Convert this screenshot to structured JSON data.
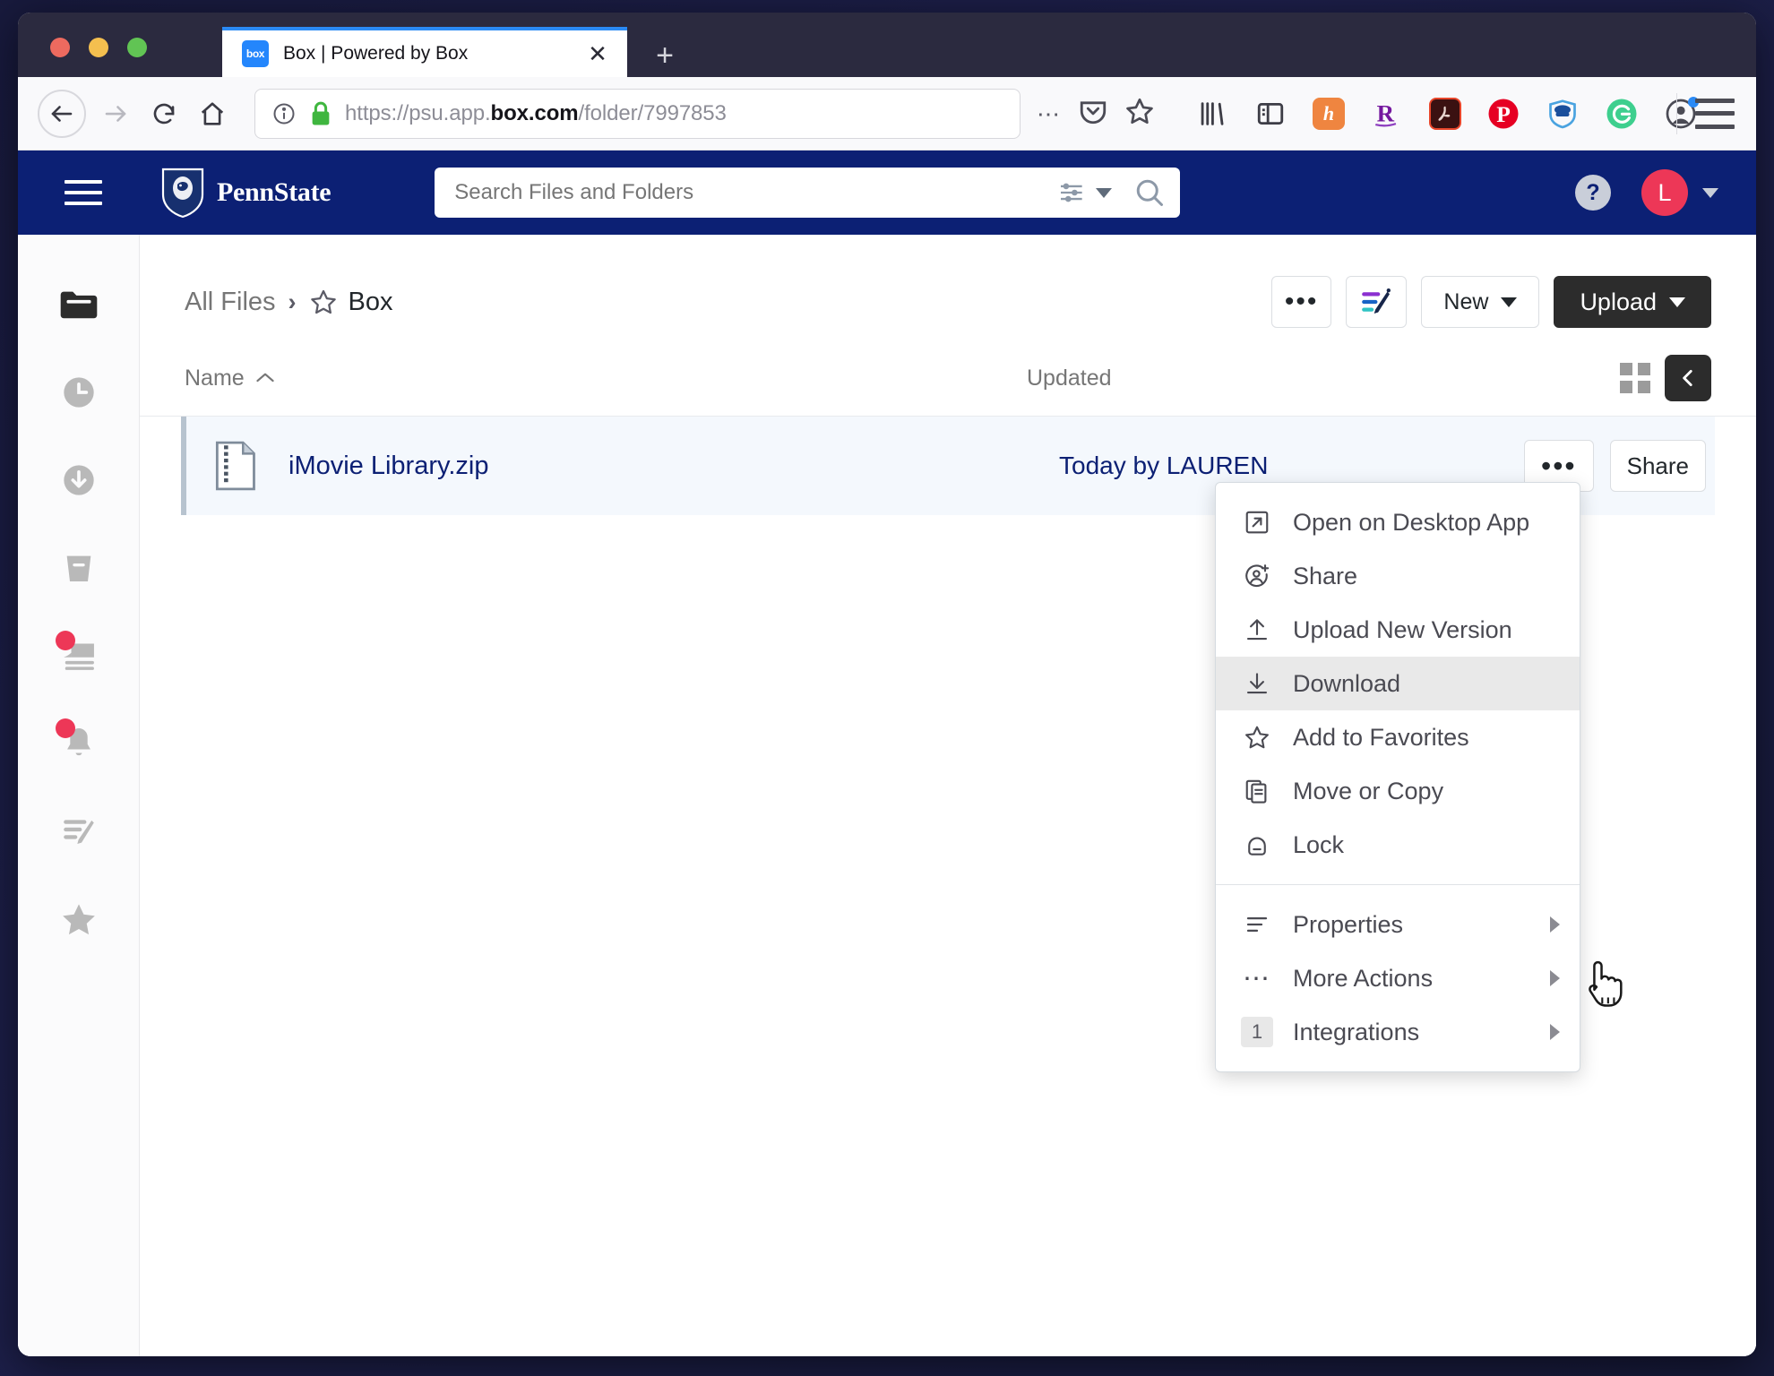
{
  "browser": {
    "tab": {
      "title": "Box | Powered by Box",
      "favicon_label": "box",
      "close_label": "✕"
    },
    "new_tab_label": "+",
    "url": {
      "scheme": "https://psu.app.",
      "domain": "box.com",
      "path": "/folder/7997853"
    },
    "toolbar_icons": [
      "page-actions-icon",
      "pocket-icon",
      "bookmark-star-icon",
      "library-icon",
      "sidebar-icon",
      "hypothesis-icon",
      "rstudio-icon",
      "adobe-acrobat-icon",
      "pinterest-icon",
      "ghostery-icon",
      "grammarly-icon",
      "account-icon",
      "firefox-menu-icon"
    ],
    "nav_icons": [
      "back-arrow-icon",
      "forward-arrow-icon",
      "reload-icon",
      "home-icon"
    ]
  },
  "box_header": {
    "menu_icon": "hamburger-menu-icon",
    "brand": "PennState",
    "search": {
      "placeholder": "Search Files and Folders",
      "value": ""
    },
    "help_label": "?",
    "avatar_initial": "L"
  },
  "sidebar": {
    "items": [
      {
        "name": "all-files",
        "icon": "folder-icon",
        "badge": false,
        "active": true
      },
      {
        "name": "recents",
        "icon": "clock-icon",
        "badge": false,
        "active": false
      },
      {
        "name": "synced",
        "icon": "download-circle-icon",
        "badge": false,
        "active": false
      },
      {
        "name": "trash",
        "icon": "trash-icon",
        "badge": false,
        "active": false
      },
      {
        "name": "feed",
        "icon": "feed-icon",
        "badge": true,
        "active": false
      },
      {
        "name": "notifications",
        "icon": "bell-icon",
        "badge": true,
        "active": false
      },
      {
        "name": "notes",
        "icon": "notes-pencil-icon",
        "badge": false,
        "active": false
      },
      {
        "name": "favorites",
        "icon": "star-icon",
        "badge": false,
        "active": false
      }
    ]
  },
  "breadcrumb": {
    "root": "All Files",
    "separator": "›",
    "current": "Box",
    "star_icon": "star-outline-icon"
  },
  "toolbar": {
    "more_label": "•••",
    "notes_icon": "box-notes-icon",
    "new_label": "New",
    "upload_label": "Upload"
  },
  "table": {
    "columns": {
      "name": "Name",
      "name_sort": "⌃",
      "updated": "Updated"
    },
    "view_toggle": {
      "grid_icon": "grid-view-icon",
      "collapse_icon": "chevron-left-icon"
    },
    "rows": [
      {
        "icon": "zip-file-icon",
        "name": "iMovie Library.zip",
        "updated": "Today by LAUREN",
        "more_label": "•••",
        "share_label": "Share"
      }
    ]
  },
  "context_menu": {
    "groups": [
      {
        "items": [
          {
            "icon": "open-external-icon",
            "label": "Open on Desktop App",
            "submenu": false,
            "highlighted": false
          },
          {
            "icon": "share-person-icon",
            "label": "Share",
            "submenu": false,
            "highlighted": false
          },
          {
            "icon": "upload-arrow-icon",
            "label": "Upload New Version",
            "submenu": false,
            "highlighted": false
          },
          {
            "icon": "download-arrow-icon",
            "label": "Download",
            "submenu": false,
            "highlighted": true
          },
          {
            "icon": "star-outline-icon",
            "label": "Add to Favorites",
            "submenu": false,
            "highlighted": false
          },
          {
            "icon": "copy-document-icon",
            "label": "Move or Copy",
            "submenu": false,
            "highlighted": false
          },
          {
            "icon": "lock-icon",
            "label": "Lock",
            "submenu": false,
            "highlighted": false
          }
        ]
      },
      {
        "items": [
          {
            "icon": "list-lines-icon",
            "label": "Properties",
            "submenu": true,
            "highlighted": false
          },
          {
            "icon": "ellipsis-icon",
            "label": "More Actions",
            "submenu": true,
            "highlighted": false
          },
          {
            "icon": "count-badge",
            "label": "Integrations",
            "submenu": true,
            "highlighted": false,
            "count": "1"
          }
        ]
      }
    ]
  },
  "colors": {
    "box_header_bg": "#0c2074",
    "avatar_bg": "#ed3757",
    "upload_btn_bg": "#2c2c2c",
    "row_selected_bg": "#f4f8fd",
    "file_name_color": "#0c2074",
    "menu_highlight_bg": "#e9e9e9",
    "desktop_bg": "#1d1f4a"
  }
}
